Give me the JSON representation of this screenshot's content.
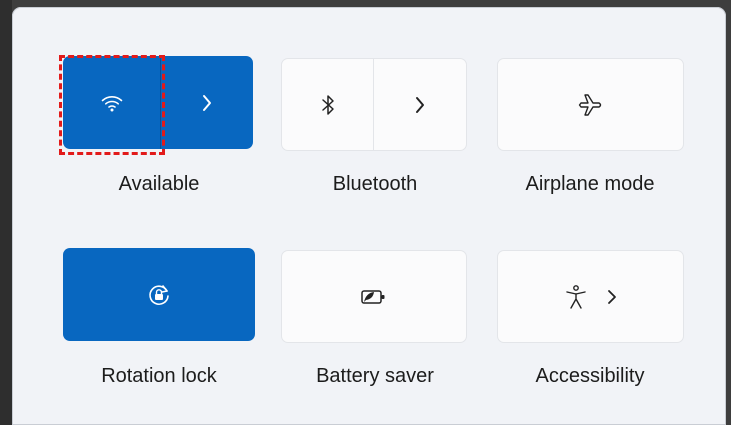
{
  "quick_settings": {
    "tiles": [
      {
        "id": "wifi",
        "label": "Available",
        "state": "on",
        "icon": "wifi-icon",
        "has_chevron": true
      },
      {
        "id": "bluetooth",
        "label": "Bluetooth",
        "state": "off",
        "icon": "bluetooth-icon",
        "has_chevron": true
      },
      {
        "id": "airplane",
        "label": "Airplane mode",
        "state": "off",
        "icon": "airplane-icon",
        "has_chevron": false
      },
      {
        "id": "rotation",
        "label": "Rotation lock",
        "state": "on",
        "icon": "rotation-lock-icon",
        "has_chevron": false
      },
      {
        "id": "battery",
        "label": "Battery saver",
        "state": "off",
        "icon": "battery-saver-icon",
        "has_chevron": false
      },
      {
        "id": "accessibility",
        "label": "Accessibility",
        "state": "off",
        "icon": "accessibility-icon",
        "has_chevron": true
      }
    ]
  },
  "colors": {
    "accent": "#0867c0",
    "panel_bg": "#f1f3f7",
    "tile_off_bg": "#fbfbfc",
    "highlight": "#e21a1a"
  }
}
